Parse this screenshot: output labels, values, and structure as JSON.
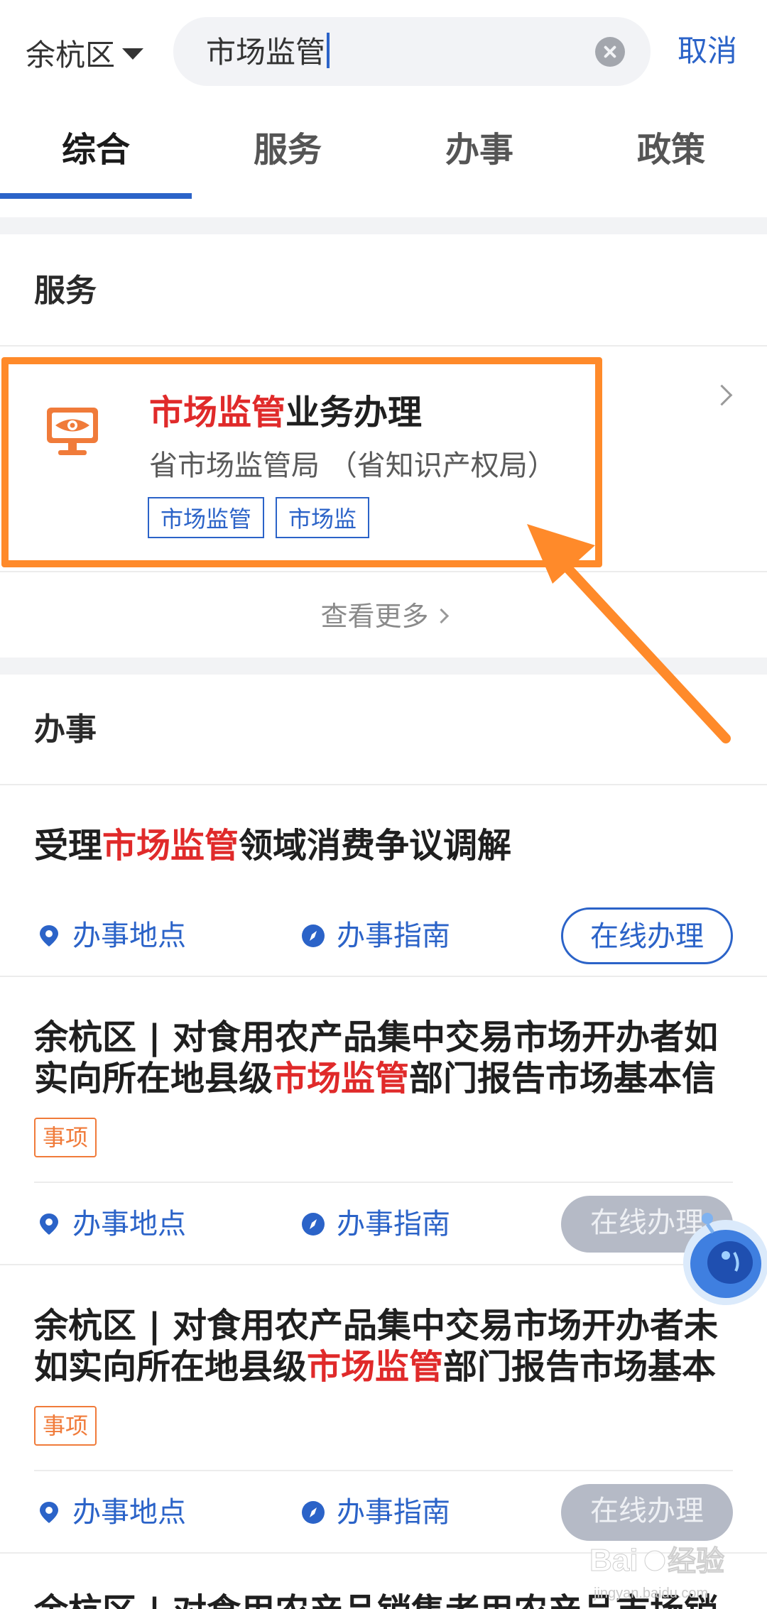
{
  "header": {
    "region": "余杭区",
    "search_value": "市场监管",
    "cancel": "取消"
  },
  "tabs": [
    {
      "label": "综合",
      "active": true
    },
    {
      "label": "服务",
      "active": false
    },
    {
      "label": "办事",
      "active": false
    },
    {
      "label": "政策",
      "active": false
    }
  ],
  "service_section": {
    "title": "服务",
    "card": {
      "title_highlight": "市场监管",
      "title_rest": "业务办理",
      "department": "省市场监管局 （省知识产权局）",
      "tags": [
        "市场监管",
        "市场监"
      ]
    },
    "see_more": "查看更多"
  },
  "affairs_section": {
    "title": "办事",
    "items": [
      {
        "title_parts": [
          {
            "text": "受理",
            "hl": false
          },
          {
            "text": "市场监管",
            "hl": true
          },
          {
            "text": "领域消费争议调解",
            "hl": false
          }
        ],
        "location": "办事地点",
        "guide": "办事指南",
        "online": "在线办理",
        "online_enabled": true
      },
      {
        "title_parts": [
          {
            "text": "余杭区 | 对食用农产品集中交易市场开办者如实向所在地县级",
            "hl": false
          },
          {
            "text": "市场监管",
            "hl": true
          },
          {
            "text": "部门报告市场基本信",
            "hl": false
          }
        ],
        "tag": "事项",
        "location": "办事地点",
        "guide": "办事指南",
        "online": "在线办理",
        "online_enabled": false
      },
      {
        "title_parts": [
          {
            "text": "余杭区 | 对食用农产品集中交易市场开办者未如实向所在地县级",
            "hl": false
          },
          {
            "text": "市场监管",
            "hl": true
          },
          {
            "text": "部门报告市场基本",
            "hl": false
          }
        ],
        "tag": "事项",
        "location": "办事地点",
        "guide": "办事指南",
        "online": "在线办理",
        "online_enabled": false
      }
    ],
    "next_item_partial": "余杭区 | 对食用农产品销售者用农产品市场销"
  },
  "watermark": {
    "brand": "Bai",
    "brand2": "经验",
    "site": "jingyan.baidu.com"
  },
  "colors": {
    "accent": "#2b63c8",
    "highlight": "#e02a2a",
    "annotation": "#ff8a2a",
    "tag_orange": "#f07b3a"
  }
}
